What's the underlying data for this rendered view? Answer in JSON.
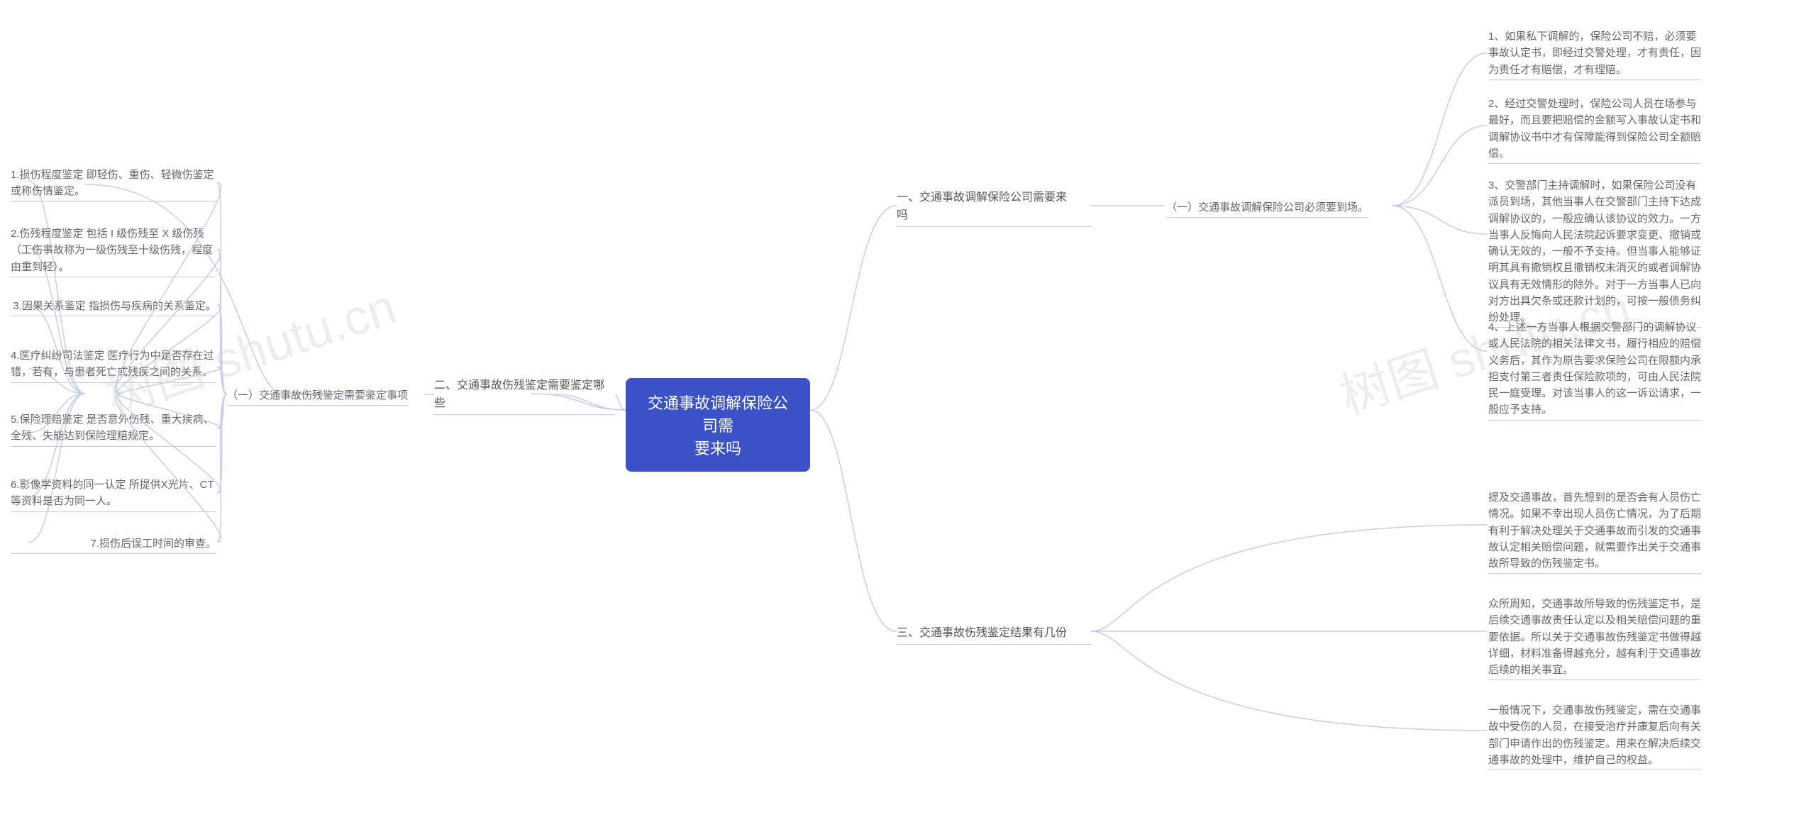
{
  "watermark": "树图 shutu.cn",
  "root": {
    "line1": "交通事故调解保险公司需",
    "line2": "要来吗"
  },
  "right": {
    "branch1": {
      "line1": "一、交通事故调解保险公司需要来",
      "line2": "吗",
      "sub1": "（一）交通事故调解保险公司必须要到场。",
      "leaf1": "1、如果私下调解的，保险公司不赔，必须要事故认定书，即经过交警处理，才有责任，因为责任才有赔偿，才有理赔。",
      "leaf2": "2、经过交警处理时，保险公司人员在场参与最好，而且要把赔偿的金额写入事故认定书和调解协议书中才有保障能得到保险公司全额赔偿。",
      "leaf3": "3、交警部门主持调解时，如果保险公司没有派员到场，其他当事人在交警部门主持下达成调解协议的，一般应确认该协议的效力。一方当事人反悔向人民法院起诉要求变更、撤销或确认无效的，一般不予支持。但当事人能够证明其具有撤销权且撤销权未消灭的或者调解协议具有无效情形的除外。对于一方当事人已向对方出具欠条或还款计划的，可按一般债务纠纷处理。",
      "leaf4": "4、上述一方当事人根据交警部门的调解协议或人民法院的相关法律文书，履行相应的赔偿义务后，其作为原告要求保险公司在限额内承担支付第三者责任保险款项的，可由人民法院民一庭受理。对该当事人的这一诉讼请求，一般应予支持。"
    },
    "branch3": {
      "label": "三、交通事故伤残鉴定结果有几份",
      "leaf1": "提及交通事故，首先想到的是否会有人员伤亡情况。如果不幸出现人员伤亡情况，为了后期有利于解决处理关于交通事故而引发的交通事故认定相关赔偿问题，就需要作出关于交通事故所导致的伤残鉴定书。",
      "leaf2": "众所周知，交通事故所导致的伤残鉴定书，是后续交通事故责任认定以及相关赔偿问题的重要依据。所以关于交通事故伤残鉴定书做得越详细，材料准备得越充分，越有利于交通事故后续的相关事宜。",
      "leaf3": "一般情况下，交通事故伤残鉴定，需在交通事故中受伤的人员，在接受治疗并康复后向有关部门申请作出的伤残鉴定。用来在解决后续交通事故的处理中，维护自己的权益。"
    }
  },
  "left": {
    "branch2": {
      "line1": "二、交通事故伤残鉴定需要鉴定哪",
      "line2": "些",
      "sub1": "（一）交通事故伤残鉴定需要鉴定事项",
      "leaf1": "1.损伤程度鉴定 即轻伤、重伤、轻微伤鉴定或称伤情鉴定。",
      "leaf2": "2.伤残程度鉴定 包括 I 级伤残至 X 级伤残（工伤事故称为一级伤残至十级伤残，程度由重到轻）。",
      "leaf3": "3.因果关系鉴定 指损伤与疾病的关系鉴定。",
      "leaf4": "4.医疗纠纷司法鉴定 医疗行为中是否存在过错，若有，与患者死亡或残疾之间的关系。",
      "leaf5": "5.保险理赔鉴定 是否意外伤残、重大疾病、全残、失能达到保险理赔规定。",
      "leaf6": "6.影像学资料的同一认定 所提供X光片、CT等资料是否为同一人。",
      "leaf7": "7.损伤后误工时间的审查。"
    }
  }
}
